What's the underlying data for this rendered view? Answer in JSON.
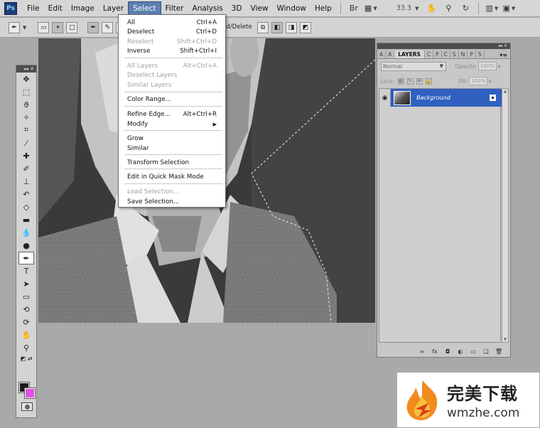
{
  "app": {
    "logo": "Ps"
  },
  "menubar": {
    "items": [
      "File",
      "Edit",
      "Image",
      "Layer",
      "Select",
      "Filter",
      "Analysis",
      "3D",
      "View",
      "Window",
      "Help"
    ],
    "active": "Select",
    "zoom": "33.3",
    "icons": [
      "bridge-icon",
      "mini-bridge-icon",
      "hand-icon",
      "zoom-icon",
      "rotate-icon",
      "arrange-icon",
      "screen-mode-icon"
    ]
  },
  "options": {
    "auto_add_label": "dd/Delete"
  },
  "select_menu": {
    "items": [
      {
        "label": "All",
        "shortcut": "Ctrl+A",
        "disabled": false
      },
      {
        "label": "Deselect",
        "shortcut": "Ctrl+D",
        "disabled": false
      },
      {
        "label": "Reselect",
        "shortcut": "Shift+Ctrl+D",
        "disabled": true
      },
      {
        "label": "Inverse",
        "shortcut": "Shift+Ctrl+I",
        "disabled": false
      },
      {
        "label": "All Layers",
        "shortcut": "Alt+Ctrl+A",
        "disabled": true
      },
      {
        "label": "Deselect Layers",
        "shortcut": "",
        "disabled": true
      },
      {
        "label": "Similar Layers",
        "shortcut": "",
        "disabled": true
      },
      {
        "label": "Color Range...",
        "shortcut": "",
        "disabled": false
      },
      {
        "label": "Refine Edge...",
        "shortcut": "Alt+Ctrl+R",
        "disabled": false
      },
      {
        "label": "Modify",
        "shortcut": "",
        "disabled": false,
        "submenu": true
      },
      {
        "label": "Grow",
        "shortcut": "",
        "disabled": false
      },
      {
        "label": "Similar",
        "shortcut": "",
        "disabled": false
      },
      {
        "label": "Transform Selection",
        "shortcut": "",
        "disabled": false
      },
      {
        "label": "Edit in Quick Mask Mode",
        "shortcut": "",
        "disabled": false
      },
      {
        "label": "Load Selection...",
        "shortcut": "",
        "disabled": true
      },
      {
        "label": "Save Selection...",
        "shortcut": "",
        "disabled": false
      }
    ]
  },
  "layers_panel": {
    "tabs": [
      "A",
      "A",
      "LAYERS",
      "C",
      "P",
      "C",
      "S",
      "N",
      "P",
      "S"
    ],
    "active_tab": "LAYERS",
    "blend_mode": "Normal",
    "opacity_label": "Opacity:",
    "opacity_value": "100%",
    "lock_label": "Lock:",
    "fill_label": "Fill:",
    "fill_value": "100%",
    "layer_name": "Background"
  },
  "colors": {
    "foreground": "#1a1a1a",
    "background": "#e052e6",
    "layer_selected": "#3060c0",
    "menu_active": "#5b7fb0"
  },
  "watermark": {
    "title": "完美下载",
    "url": "wmzhe.com"
  }
}
